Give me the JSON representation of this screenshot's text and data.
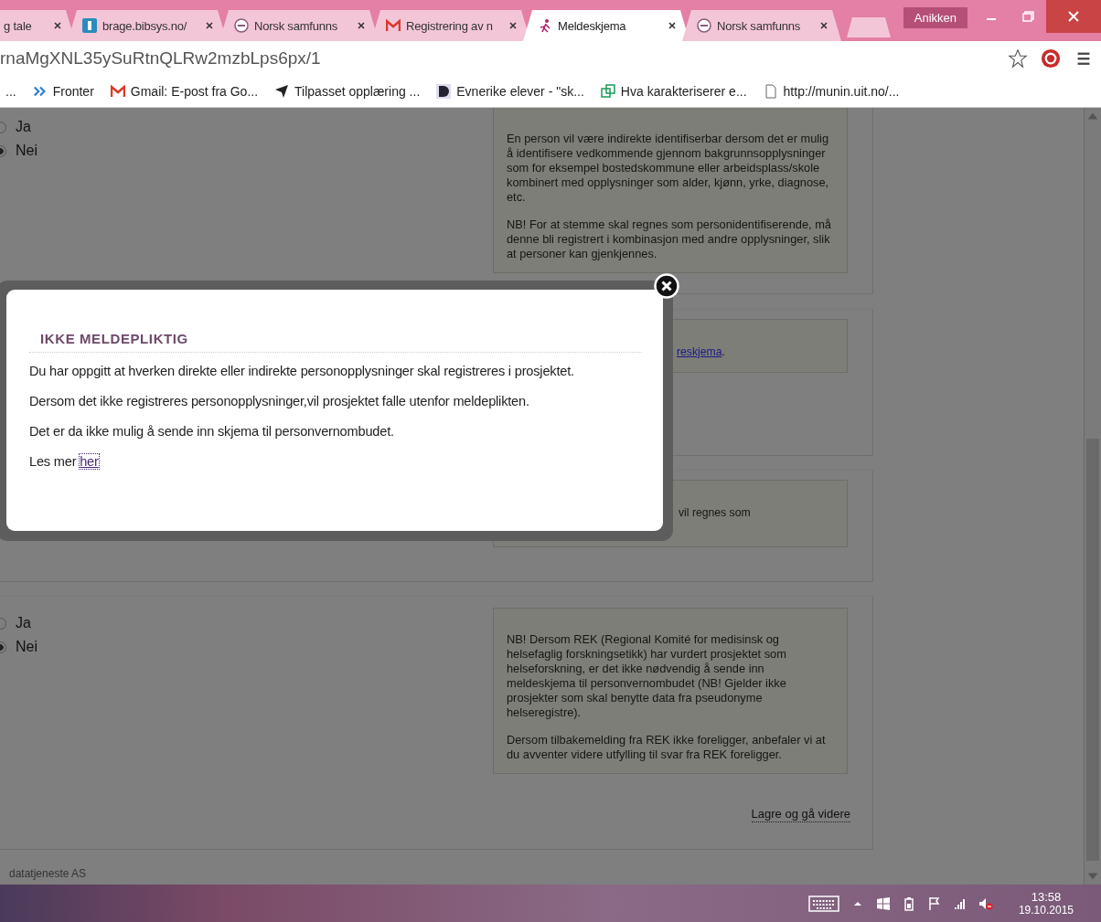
{
  "browser": {
    "tabs": [
      {
        "title": "g tale",
        "kind": "none",
        "selected": false
      },
      {
        "title": "brage.bibsys.no/",
        "kind": "bibsys",
        "selected": false
      },
      {
        "title": "Norsk samfunns",
        "kind": "nsd",
        "selected": false
      },
      {
        "title": "Registrering av n",
        "kind": "gmail",
        "selected": false
      },
      {
        "title": "Meldeskjema",
        "kind": "figure",
        "selected": true
      },
      {
        "title": "Norsk samfunns",
        "kind": "nsd",
        "selected": false
      }
    ],
    "profile": "Anikken",
    "address": "rnaMgXNL35ySuRtnQLRw2mzbLps6px/1",
    "bookmarks": [
      {
        "label": "...",
        "kind": "none"
      },
      {
        "label": "Fronter",
        "kind": "arrows"
      },
      {
        "label": "Gmail: E-post fra Go...",
        "kind": "gmail"
      },
      {
        "label": "Tilpasset opplæring ...",
        "kind": "plane"
      },
      {
        "label": "Evnerike elever - \"sk...",
        "kind": "letter"
      },
      {
        "label": "Hva karakteriserer e...",
        "kind": "squares"
      },
      {
        "label": "http://munin.uit.no/...",
        "kind": "page"
      }
    ]
  },
  "page": {
    "sections": [
      {
        "radios": [
          {
            "label": "Ja",
            "selected": false
          },
          {
            "label": "Nei",
            "selected": true
          }
        ],
        "help": [
          "En person vil være indirekte identifiserbar dersom det er mulig å identifisere vedkommende gjennom bakgrunnsopplysninger som for eksempel bostedskommune eller arbeidsplass/skole kombinert med opplysninger som alder, kjønn, yrke, diagnose, etc.",
          "NB! For at stemme skal regnes som personidentifiserende, må denne bli registrert i kombinasjon med andre opplysninger, slik at personer kan gjenkjennes."
        ]
      },
      {
        "help_link": "reskjema",
        "help_tail": "."
      },
      {
        "help_fragment": "vil regnes som"
      },
      {
        "radios": [
          {
            "label": "Ja",
            "selected": false
          },
          {
            "label": "Nei",
            "selected": true
          }
        ],
        "help": [
          "NB! Dersom REK (Regional Komité for medisinsk og helsefaglig forskningsetikk) har vurdert prosjektet som helseforskning, er det ikke nødvendig å sende inn meldeskjema til personvernombudet (NB! Gjelder ikke prosjekter som skal benytte data fra pseudonyme helseregistre).",
          "Dersom tilbakemelding fra REK ikke foreligger, anbefaler vi at du avventer videre utfylling til svar fra REK foreligger."
        ],
        "save_button": "Lagre og gå videre"
      }
    ],
    "footer": "datatjeneste AS"
  },
  "dialog": {
    "title": "IKKE MELDEPLIKTIG",
    "paragraphs": [
      "Du har oppgitt at hverken direkte eller indirekte personopplysninger skal registreres i prosjektet.",
      "Dersom det ikke registreres personopplysninger,vil prosjektet falle utenfor meldeplikten.",
      "Det er da ikke mulig å sende inn skjema til personvernombudet."
    ],
    "more_text": "Les mer",
    "more_link": "her"
  },
  "taskbar": {
    "time": "13:58",
    "date": "19.10.2015"
  }
}
